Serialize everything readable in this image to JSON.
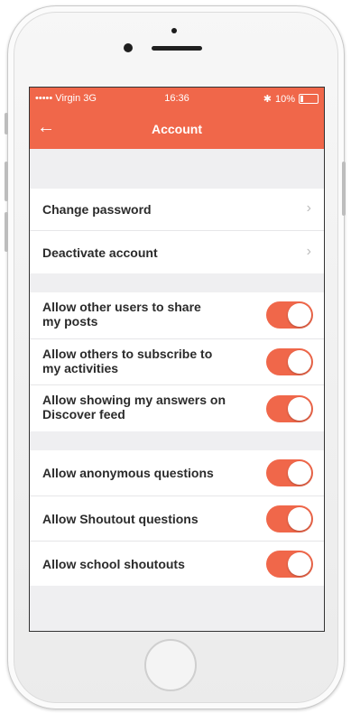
{
  "status_bar": {
    "carrier": "••••• Virgin  3G",
    "time": "16:36",
    "bluetooth": "✱",
    "battery": "10%"
  },
  "navbar": {
    "back_glyph": "←",
    "title": "Account"
  },
  "password_section": [
    {
      "label": "Change password",
      "chevron": "›"
    },
    {
      "label": "Deactivate account",
      "chevron": "›"
    }
  ],
  "sharing_section": [
    {
      "label_line1": "Allow other users to share",
      "label_line2": "my posts",
      "on": true
    },
    {
      "label_line1": "Allow others to subscribe to",
      "label_line2": "my activities",
      "on": true
    },
    {
      "label_line1": "Allow showing my answers on",
      "label_line2": "Discover feed",
      "on": true
    }
  ],
  "questions_section": [
    {
      "label": "Allow anonymous questions",
      "on": true
    },
    {
      "label": "Allow Shoutout questions",
      "on": true
    },
    {
      "label": "Allow school shoutouts",
      "on": true
    }
  ],
  "colors": {
    "accent": "#f0674a",
    "background": "#efeff1",
    "row": "#ffffff",
    "text": "#2b2b2b"
  }
}
